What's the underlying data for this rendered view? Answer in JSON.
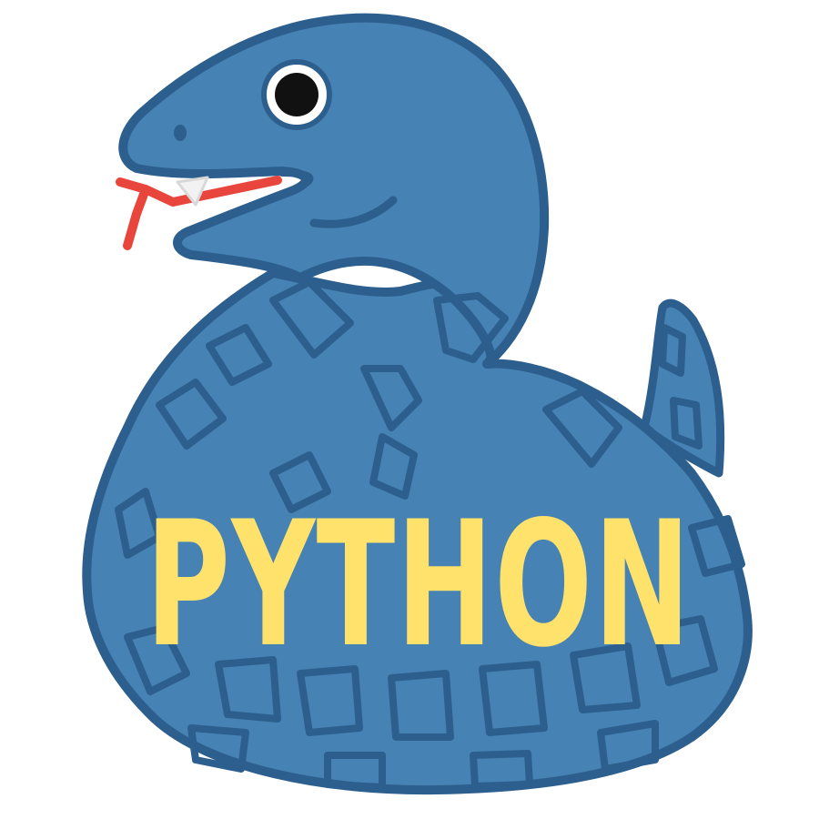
{
  "logo": {
    "text": "PYTHON",
    "text_color": "#FFE26B",
    "body_color": "#4682B4",
    "outline_color": "#2C5F8E",
    "tongue_color": "#E8453C",
    "eye_white": "#FFFFFF",
    "pupil_color": "#111111"
  },
  "icons": [
    "snake-mascot-icon"
  ]
}
